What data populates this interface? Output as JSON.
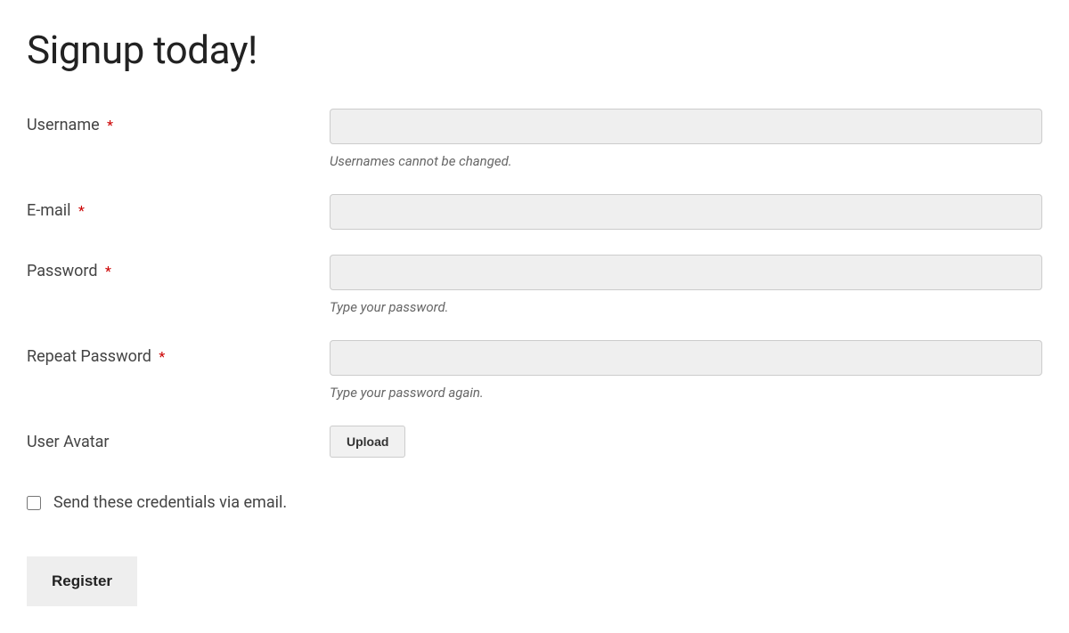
{
  "title": "Signup today!",
  "fields": {
    "username": {
      "label": "Username",
      "required_marker": "*",
      "help": "Usernames cannot be changed."
    },
    "email": {
      "label": "E-mail",
      "required_marker": "*"
    },
    "password": {
      "label": "Password",
      "required_marker": "*",
      "help": "Type your password."
    },
    "repeat_password": {
      "label": "Repeat Password",
      "required_marker": "*",
      "help": "Type your password again."
    },
    "avatar": {
      "label": "User Avatar",
      "upload_button": "Upload"
    }
  },
  "checkbox": {
    "label": "Send these credentials via email."
  },
  "submit": {
    "label": "Register"
  }
}
